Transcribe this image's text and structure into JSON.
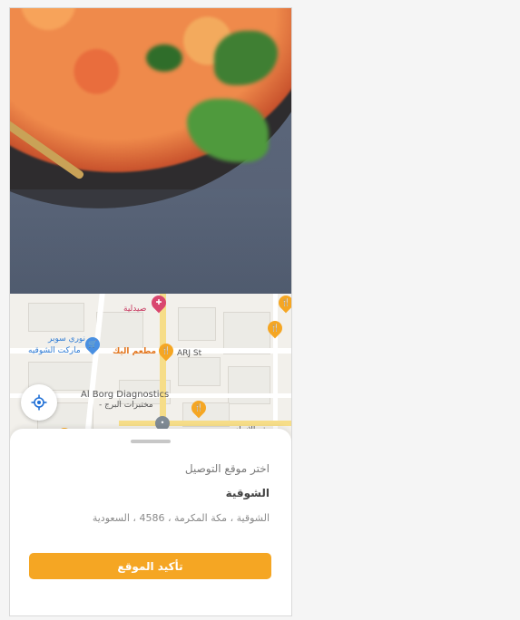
{
  "map": {
    "labels": {
      "pharmacy": "صيدلية",
      "nouri_super": "نوري سوبر",
      "shoqiya_market": "ماركت الشوقيه",
      "restaurant": "مطعم اليك",
      "street": "ARJ St",
      "diagnostics_en": "Al Borg Diagnostics",
      "diagnostics_ar": "مختبرات البرج -",
      "bank": "مصرف الإنماء"
    }
  },
  "sheet": {
    "prompt": "اختر موقع التوصيل",
    "title": "الشوقية",
    "address": "الشوقية ، مكة المكرمة ، 4586 ، السعودية",
    "confirm_label": "تأكيد الموقع"
  },
  "colors": {
    "accent": "#f5a623",
    "pin_orange": "#f5a623",
    "pin_blue": "#4a90e2",
    "pin_pink": "#d9466f",
    "locate_icon": "#1f6fd6"
  },
  "icons": {
    "locate": "crosshair-locate-icon",
    "restaurant_pin": "fork-knife-pin-icon"
  }
}
